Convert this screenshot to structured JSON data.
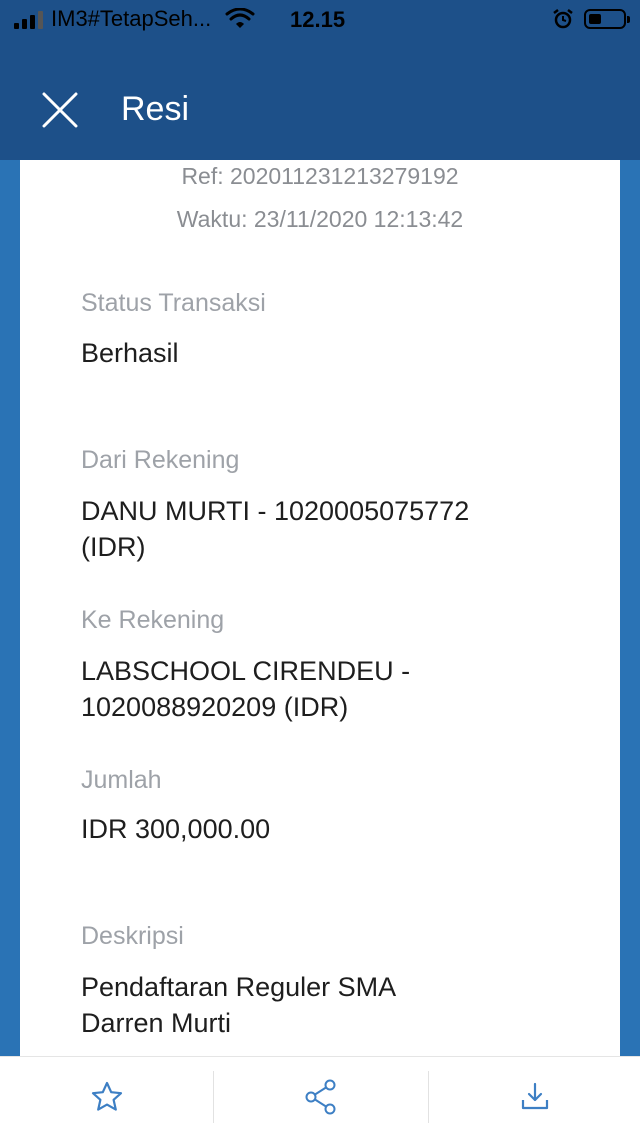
{
  "status_bar": {
    "carrier": "IM3#TetapSeh...",
    "time": "12.15"
  },
  "header": {
    "title": "Resi"
  },
  "receipt": {
    "ref": "Ref: 202011231213279192",
    "waktu": "Waktu: 23/11/2020 12:13:42",
    "fields": [
      {
        "label": "Status Transaksi",
        "value": "Berhasil"
      },
      {
        "label": "Dari Rekening",
        "value_lines": [
          "DANU MURTI - 1020005075772",
          "(IDR)"
        ]
      },
      {
        "label": "Ke Rekening",
        "value_lines": [
          "LABSCHOOL CIRENDEU -",
          "1020088920209 (IDR)"
        ]
      },
      {
        "label": "Jumlah",
        "value": "IDR 300,000.00"
      },
      {
        "label": "Deskripsi",
        "value_lines": [
          "Pendaftaran Reguler SMA",
          "Darren Murti"
        ]
      }
    ]
  },
  "toolbar": {
    "icons": [
      "star-icon",
      "share-icon",
      "download-icon"
    ],
    "accent": "#3d7fc4"
  },
  "colors": {
    "header_bg": "#1d5089",
    "side_bg": "#2a73b5",
    "label_gray": "#9ea2a8",
    "value_dark": "#1e1e1e"
  }
}
